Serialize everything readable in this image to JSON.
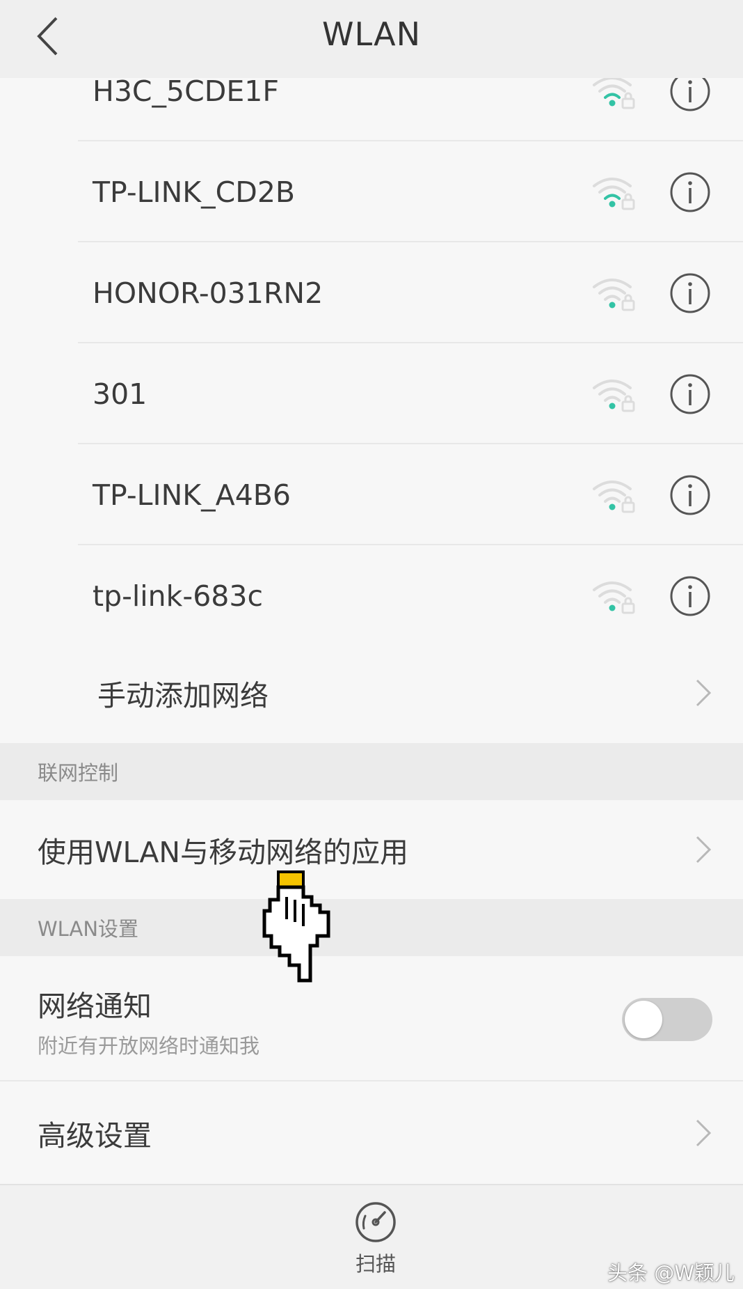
{
  "header": {
    "title": "WLAN"
  },
  "networks": [
    {
      "ssid": "H3C_5CDE1F",
      "signal": 2
    },
    {
      "ssid": "TP-LINK_CD2B",
      "signal": 2
    },
    {
      "ssid": "HONOR-031RN2",
      "signal": 1
    },
    {
      "ssid": "301",
      "signal": 1
    },
    {
      "ssid": "TP-LINK_A4B6",
      "signal": 1
    },
    {
      "ssid": "tp-link-683c",
      "signal": 1
    }
  ],
  "manual_add": {
    "label": "手动添加网络"
  },
  "sections": {
    "network_control": "联网控制",
    "wlan_settings": "WLAN设置"
  },
  "apps_row": {
    "label": "使用WLAN与移动网络的应用"
  },
  "notify": {
    "title": "网络通知",
    "subtitle": "附近有开放网络时通知我",
    "enabled": false
  },
  "advanced": {
    "label": "高级设置"
  },
  "bottom": {
    "scan_label": "扫描"
  },
  "watermark": "头条 @W颖儿",
  "colors": {
    "signal_active": "#33c3a5",
    "signal_inactive": "#dcdcdc",
    "cursor_highlight": "#f5c400"
  }
}
